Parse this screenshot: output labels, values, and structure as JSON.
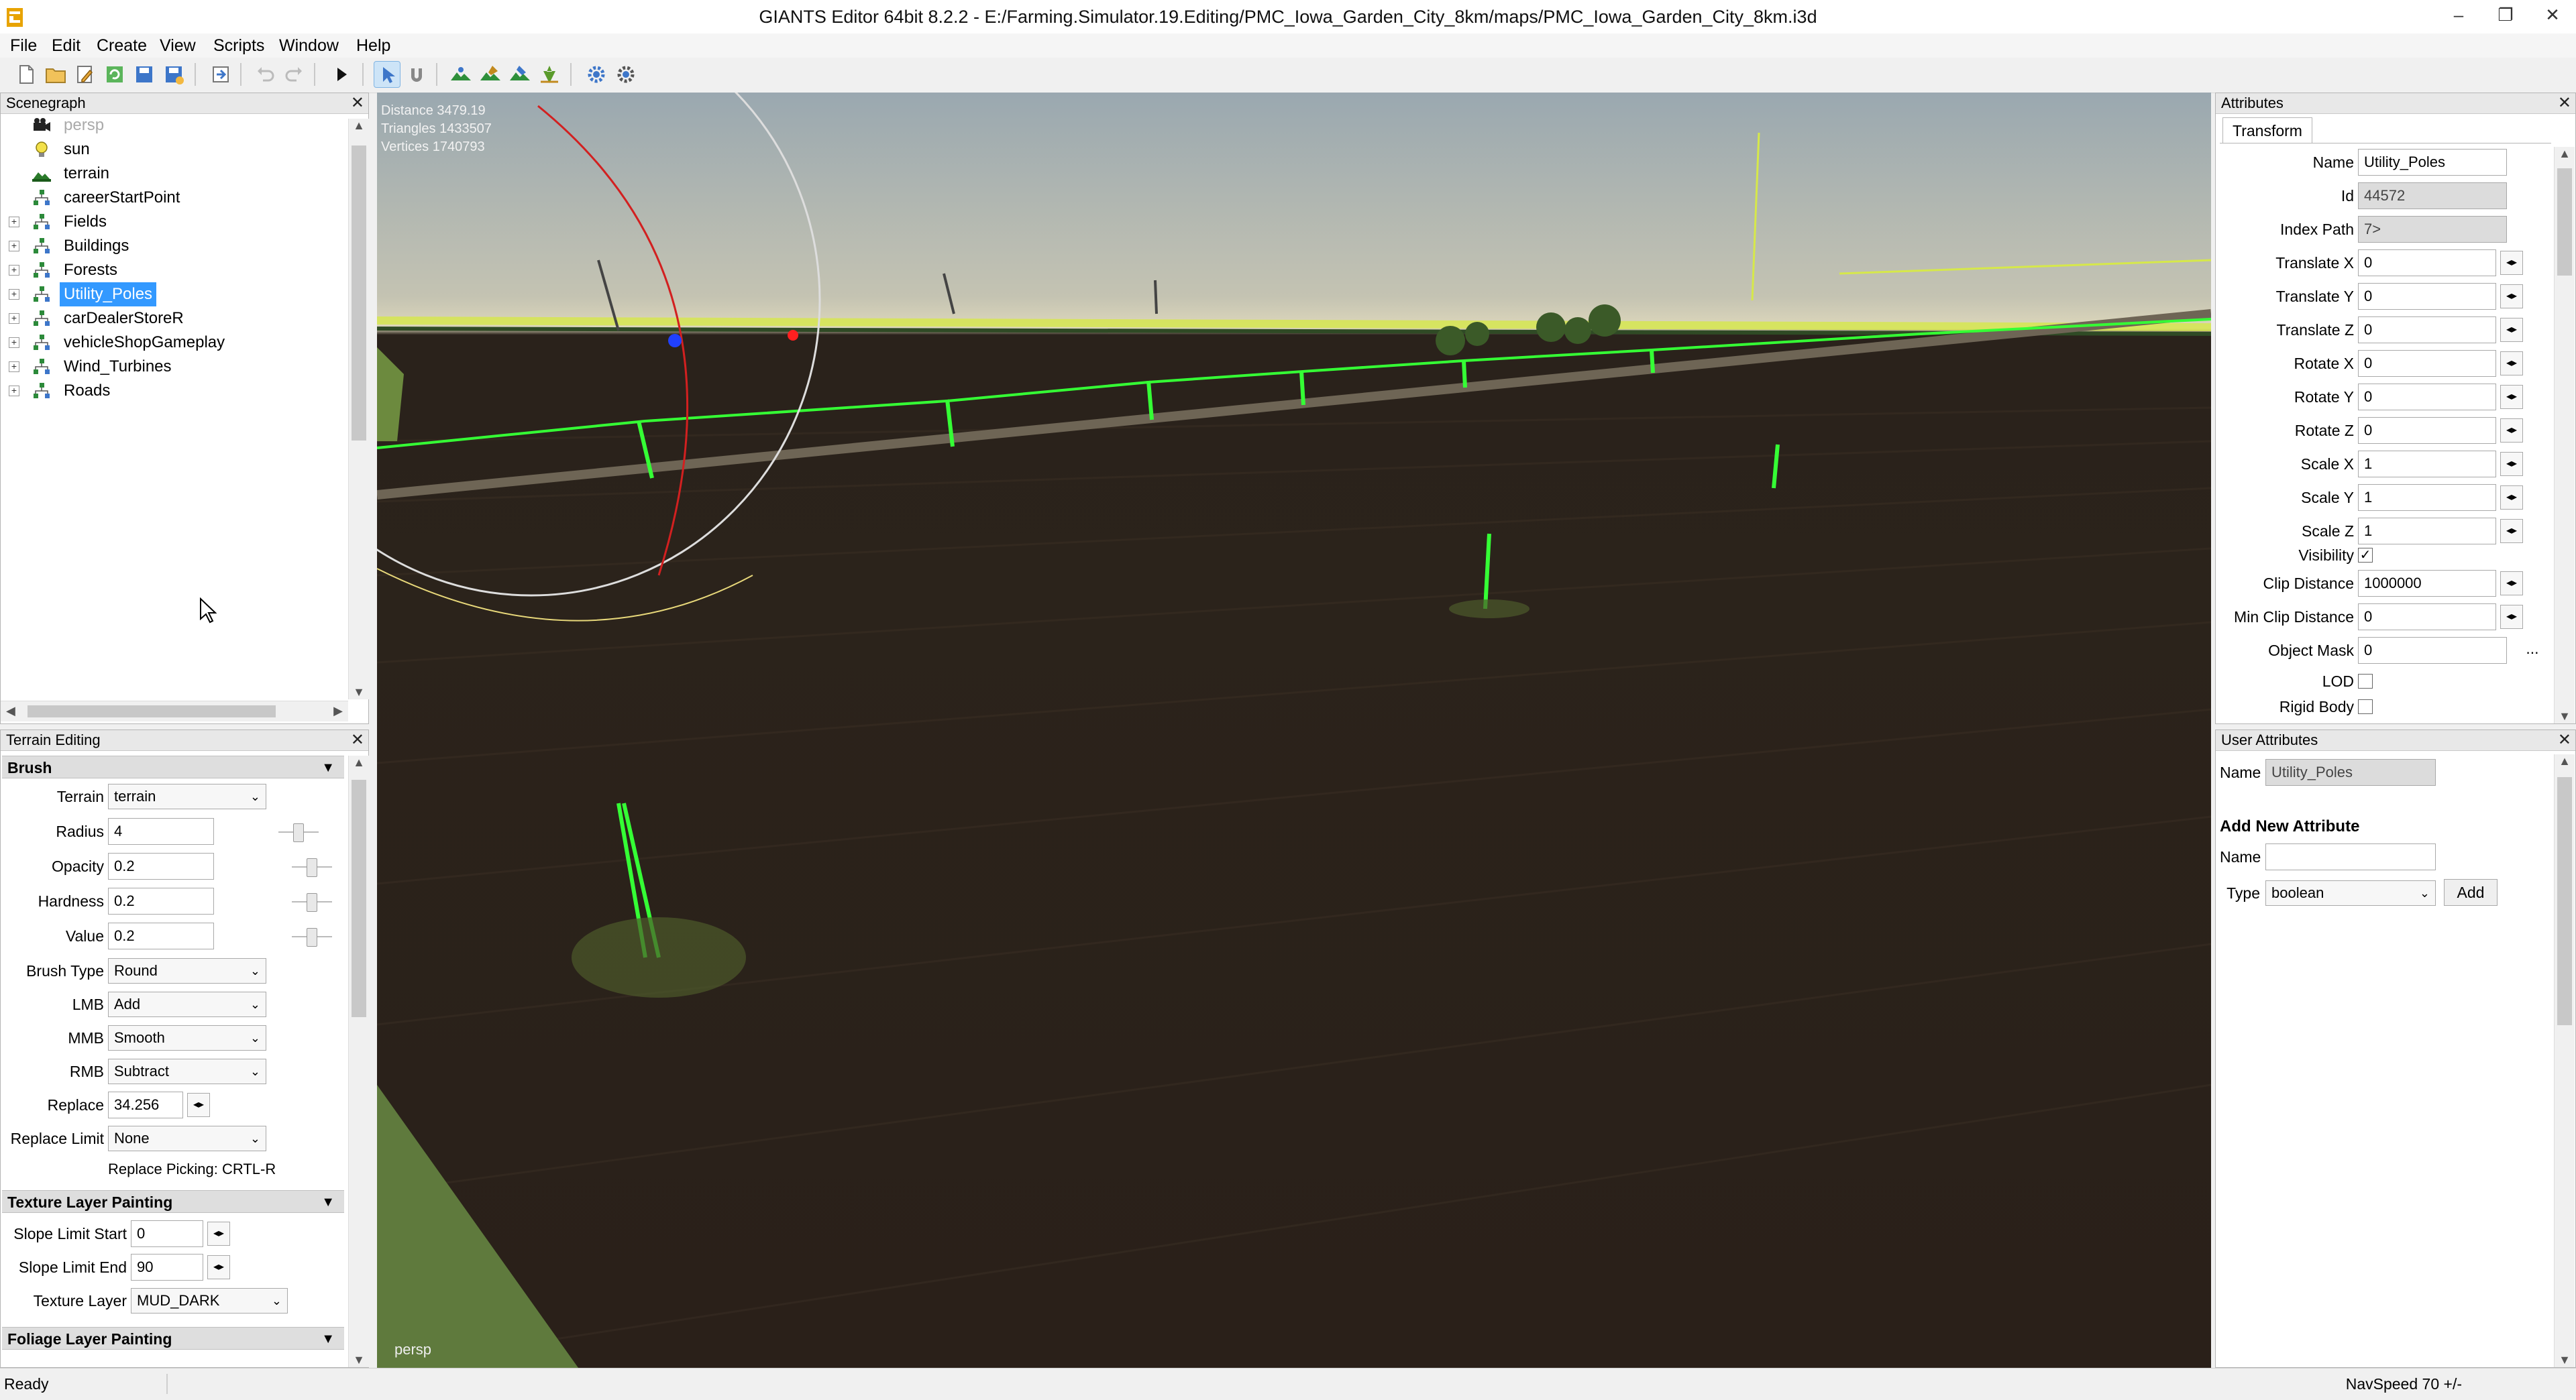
{
  "window": {
    "title": "GIANTS Editor 64bit 8.2.2 - E:/Farming.Simulator.19.Editing/PMC_Iowa_Garden_City_8km/maps/PMC_Iowa_Garden_City_8km.i3d",
    "controls": {
      "minimize": "–",
      "restore": "❐",
      "close": "✕"
    }
  },
  "menu": [
    "File",
    "Edit",
    "Create",
    "View",
    "Scripts",
    "Window",
    "Help"
  ],
  "toolbar": {
    "buttons": [
      "new-file-icon",
      "open-folder-icon",
      "edit-icon",
      "refresh-icon",
      "save-icon",
      "save-as-icon",
      "import-icon",
      "undo-icon",
      "redo-icon",
      "play-icon",
      "select-mode-icon",
      "magnet-icon",
      "terrain-sculpt-icon",
      "terrain-paint-icon",
      "foliage-paint-icon",
      "object-place-icon",
      "settings-gear-icon",
      "help-gear-icon"
    ]
  },
  "scenegraph": {
    "title": "Scenegraph",
    "close": "✕",
    "items": [
      {
        "label": "persp",
        "icon": "camera-icon"
      },
      {
        "label": "sun",
        "icon": "light-bulb-icon"
      },
      {
        "label": "terrain",
        "icon": "terrain-icon"
      },
      {
        "label": "careerStartPoint",
        "icon": "transform-group-icon"
      },
      {
        "label": "Fields",
        "icon": "transform-group-icon",
        "exp": "+"
      },
      {
        "label": "Buildings",
        "icon": "transform-group-icon",
        "exp": "+"
      },
      {
        "label": "Forests",
        "icon": "transform-group-icon",
        "exp": "+"
      },
      {
        "label": "Utility_Poles",
        "icon": "transform-group-icon",
        "exp": "+"
      },
      {
        "label": "carDealerStoreR",
        "icon": "transform-group-icon",
        "exp": "+"
      },
      {
        "label": "vehicleShopGameplay",
        "icon": "transform-group-icon",
        "exp": "+"
      },
      {
        "label": "Wind_Turbines",
        "icon": "transform-group-icon",
        "exp": "+"
      },
      {
        "label": "Roads",
        "icon": "transform-group-icon",
        "exp": "+"
      }
    ]
  },
  "terrain_editing": {
    "title": "Terrain Editing",
    "close": "✕",
    "brush_section": "Brush",
    "terrain_label": "Terrain",
    "terrain_value": "terrain",
    "radius_label": "Radius",
    "radius_value": "4",
    "opacity_label": "Opacity",
    "opacity_value": "0.2",
    "hardness_label": "Hardness",
    "hardness_value": "0.2",
    "value_label": "Value",
    "value_value": "0.2",
    "brush_type_label": "Brush Type",
    "brush_type_value": "Round",
    "lmb_label": "LMB",
    "lmb_value": "Add",
    "mmb_label": "MMB",
    "mmb_value": "Smooth",
    "rmb_label": "RMB",
    "rmb_value": "Subtract",
    "replace_label": "Replace",
    "replace_value": "34.256",
    "replace_limit_label": "Replace Limit",
    "replace_limit_value": "None",
    "replace_picking": "Replace Picking: CRTL-R",
    "texture_section": "Texture Layer Painting",
    "slope_start_label": "Slope Limit Start",
    "slope_start_value": "0",
    "slope_end_label": "Slope Limit End",
    "slope_end_value": "90",
    "texture_layer_label": "Texture Layer",
    "texture_layer_value": "MUD_DARK",
    "foliage_section": "Foliage Layer Painting"
  },
  "viewport": {
    "distance": "Distance 3479.19",
    "triangles": "Triangles 1433507",
    "vertices": "Vertices 1740793",
    "camera": "persp"
  },
  "attributes": {
    "title": "Attributes",
    "close": "✕",
    "tab": "Transform",
    "more_button": "...",
    "fields": [
      {
        "label": "Name",
        "value": "Utility_Poles",
        "ro": false,
        "spin": false
      },
      {
        "label": "Id",
        "value": "44572",
        "ro": true,
        "spin": false
      },
      {
        "label": "Index Path",
        "value": "7>",
        "ro": true,
        "spin": false
      },
      {
        "label": "Translate X",
        "value": "0",
        "ro": false,
        "spin": true
      },
      {
        "label": "Translate Y",
        "value": "0",
        "ro": false,
        "spin": true
      },
      {
        "label": "Translate Z",
        "value": "0",
        "ro": false,
        "spin": true
      },
      {
        "label": "Rotate X",
        "value": "0",
        "ro": false,
        "spin": true
      },
      {
        "label": "Rotate Y",
        "value": "0",
        "ro": false,
        "spin": true
      },
      {
        "label": "Rotate Z",
        "value": "0",
        "ro": false,
        "spin": true
      },
      {
        "label": "Scale X",
        "value": "1",
        "ro": false,
        "spin": true
      },
      {
        "label": "Scale Y",
        "value": "1",
        "ro": false,
        "spin": true
      },
      {
        "label": "Scale Z",
        "value": "1",
        "ro": false,
        "spin": true
      }
    ],
    "visibility_label": "Visibility",
    "visibility_checked": "✓",
    "clip_distance_label": "Clip Distance",
    "clip_distance_value": "1000000",
    "min_clip_label": "Min Clip Distance",
    "min_clip_value": "0",
    "object_mask_label": "Object Mask",
    "object_mask_value": "0",
    "lod_label": "LOD",
    "rigid_body_label": "Rigid Body"
  },
  "user_attributes": {
    "title": "User Attributes",
    "close": "✕",
    "name_label": "Name",
    "name_value": "Utility_Poles",
    "add_heading": "Add New Attribute",
    "new_name_label": "Name",
    "new_name_value": "",
    "type_label": "Type",
    "type_value": "boolean",
    "add_button": "Add"
  },
  "status": {
    "left": "Ready",
    "right": "NavSpeed 70 +/-"
  }
}
